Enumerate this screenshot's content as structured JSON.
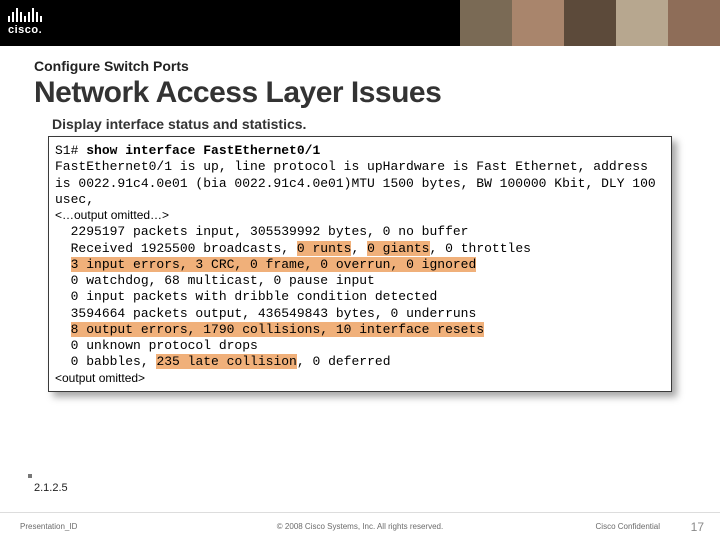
{
  "brand": {
    "name": "cisco."
  },
  "header": {
    "subheading": "Configure Switch Ports",
    "title": "Network Access Layer Issues",
    "caption": "Display interface status and statistics."
  },
  "terminal": {
    "prompt": "S1#",
    "command": "show interface FastEthernet0/1",
    "line1": "FastEthernet0/1 is up, line protocol is upHardware is Fast Ethernet, address is 0022.91c4.0e01 (bia 0022.91c4.0e01)MTU 1500 bytes, BW 100000 Kbit, DLY 100 usec,",
    "omitted_top": "<…output omitted…>",
    "stats_a": "  2295197 packets input, 305539992 bytes, 0 no buffer\n  Received 1925500 broadcasts, ",
    "hl_runts": "0 runts",
    "sep1": ", ",
    "hl_giants": "0 giants",
    "sep2": ", ",
    "stats_b": "0 throttles\n  ",
    "hl_line_errors": "3 input errors, 3 CRC, 0 frame, 0 overrun, 0 ignored",
    "stats_c": "\n  0 watchdog, 68 multicast, 0 pause input\n  0 input packets with dribble condition detected\n  3594664 packets output, 436549843 bytes, 0 underruns\n  ",
    "hl_line_output": "8 output errors, 1790 collisions, 10 interface resets",
    "stats_d": "\n  0 unknown protocol drops\n  0 babbles, ",
    "hl_late": "235 late collision",
    "stats_e": ", 0 deferred",
    "omitted_bottom": "<output omitted>"
  },
  "section_number": "2.1.2.5",
  "footer": {
    "presentation_id": "Presentation_ID",
    "copyright": "© 2008 Cisco Systems, Inc. All rights reserved.",
    "confidential": "Cisco Confidential",
    "page": "17"
  }
}
